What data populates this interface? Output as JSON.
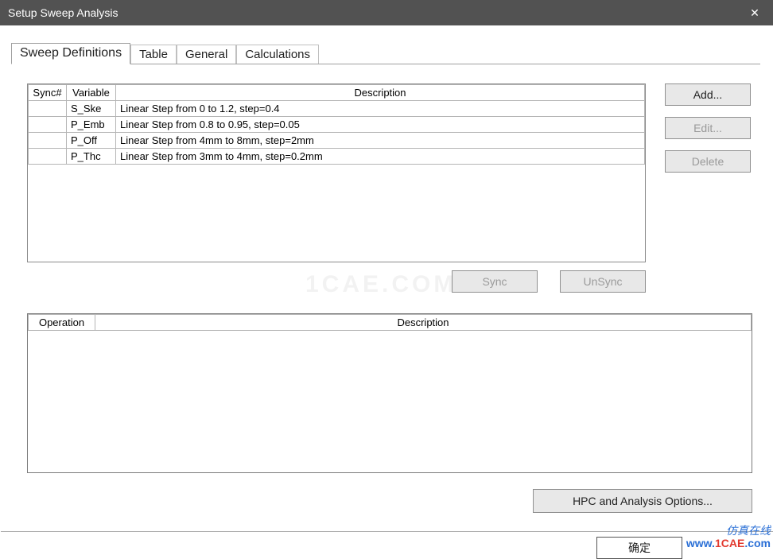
{
  "window": {
    "title": "Setup Sweep Analysis"
  },
  "tabs": {
    "sweep_definitions": "Sweep Definitions",
    "table": "Table",
    "general": "General",
    "calculations": "Calculations"
  },
  "grid1": {
    "headers": {
      "sync": "Sync#",
      "variable": "Variable",
      "description": "Description"
    },
    "rows": [
      {
        "sync": "",
        "variable": "S_Ske",
        "description": "Linear Step from 0 to 1.2, step=0.4"
      },
      {
        "sync": "",
        "variable": "P_Emb",
        "description": "Linear Step from 0.8 to 0.95, step=0.05"
      },
      {
        "sync": "",
        "variable": "P_Off",
        "description": "Linear Step from 4mm to 8mm, step=2mm"
      },
      {
        "sync": "",
        "variable": "P_Thc",
        "description": "Linear Step from 3mm to 4mm, step=0.2mm"
      }
    ]
  },
  "buttons": {
    "add": "Add...",
    "edit": "Edit...",
    "delete": "Delete",
    "sync": "Sync",
    "unsync": "UnSync",
    "hpc": "HPC and Analysis Options...",
    "ok": "确定"
  },
  "grid2": {
    "headers": {
      "operation": "Operation",
      "description": "Description"
    }
  },
  "watermark": "1CAE.COM",
  "logo": {
    "line1": "仿真在线",
    "line2_a": "www.",
    "line2_b": "1CAE",
    "line2_c": ".com"
  }
}
